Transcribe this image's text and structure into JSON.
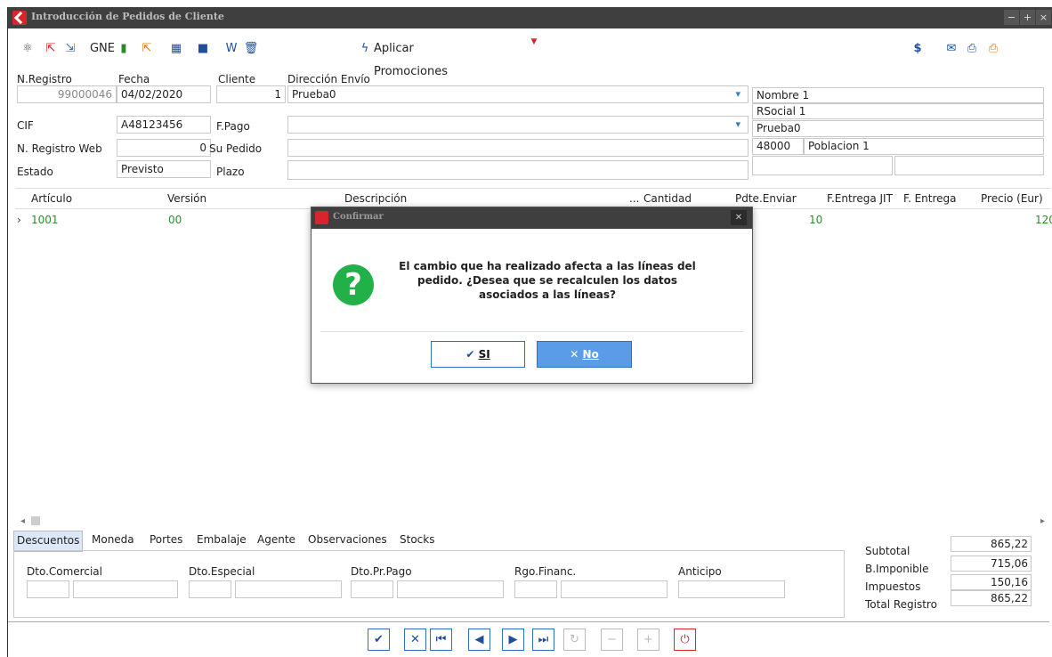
{
  "window": {
    "title": "Introducción de Pedidos de Cliente",
    "controls": [
      "−",
      "+",
      "×"
    ]
  },
  "toolbar": {
    "gne_label": "GNE",
    "promo_label": "Aplicar Promociones",
    "dollar": "$"
  },
  "header": {
    "nregistro_label": "N.Registro",
    "nregistro_value": "99000046",
    "fecha_label": "Fecha",
    "fecha_value": "04/02/2020",
    "cliente_label": "Cliente",
    "cliente_value": "1",
    "direccion_label": "Dirección Envío",
    "direccion_value": "Prueba0",
    "cif_label": "CIF",
    "cif_value": "A48123456",
    "fpago_label": "F.Pago",
    "fpago_value": "",
    "nregweb_label": "N. Registro Web",
    "nregweb_value": "0",
    "supedido_label": "Su Pedido",
    "supedido_value": "",
    "estado_label": "Estado",
    "estado_value": "Previsto",
    "plazo_label": "Plazo",
    "plazo_value": "",
    "nombre": "Nombre 1",
    "rsocial": "RSocial 1",
    "direccion2": "Prueba0",
    "cp": "48000",
    "poblacion": "Poblacion 1"
  },
  "grid": {
    "headers": [
      "Artículo",
      "Versión",
      "Descripción",
      "...",
      "Cantidad",
      "Pdte.Enviar",
      "F.Entrega JIT",
      "F. Entrega",
      "Precio (Eur)"
    ],
    "row": {
      "articulo": "1001",
      "version": "00",
      "pdte": "10",
      "precio": "120"
    }
  },
  "tabs": [
    "Descuentos",
    "Moneda",
    "Portes",
    "Embalaje",
    "Agente",
    "Observaciones",
    "Stocks"
  ],
  "panel": {
    "dto_comercial": "Dto.Comercial",
    "dto_especial": "Dto.Especial",
    "dto_prpago": "Dto.Pr.Pago",
    "rgo_financ": "Rgo.Financ.",
    "anticipo": "Anticipo"
  },
  "totals": {
    "subtotal_label": "Subtotal",
    "subtotal": "865,22",
    "bimponible_label": "B.Imponible",
    "bimponible": "715,06",
    "impuestos_label": "Impuestos",
    "impuestos": "150,16",
    "total_label": "Total Registro",
    "total": "865,22"
  },
  "dialog": {
    "title": "Confirmar",
    "message": "El cambio que ha realizado afecta a las líneas del pedido. ¿Desea que se recalculen los datos asociados a las líneas?",
    "yes_label": "SI",
    "no_label": "No"
  },
  "colors": {
    "accent": "#2f6fc1",
    "danger": "#d9242b",
    "ok": "#22b148"
  }
}
